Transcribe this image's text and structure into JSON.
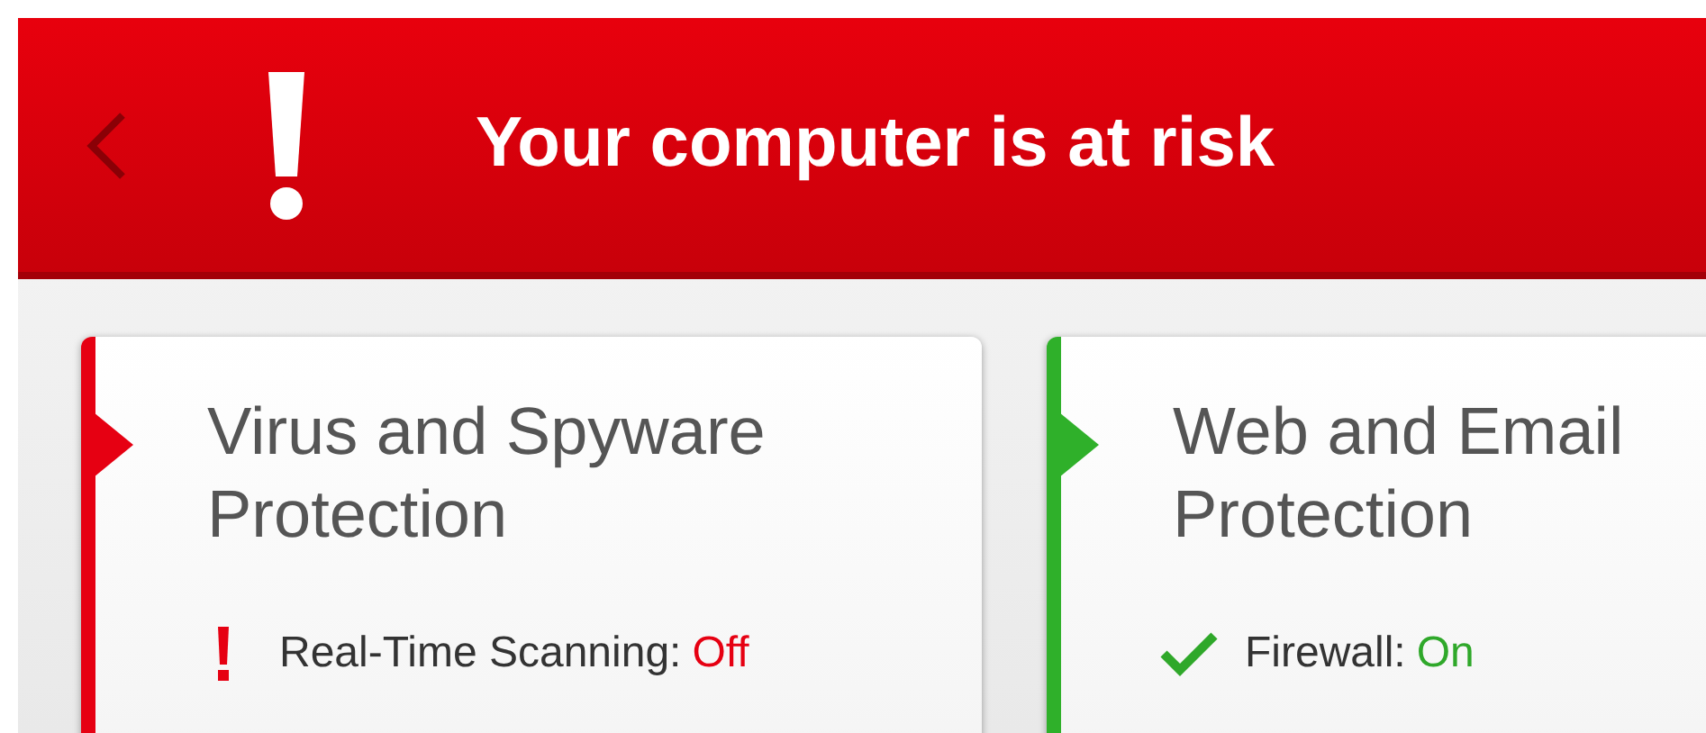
{
  "header": {
    "title": "Your computer is at risk"
  },
  "cards": [
    {
      "title": "Virus and Spyware Protection",
      "color": "#e60012",
      "items": [
        {
          "label": "Real-Time Scanning:",
          "value": "Off",
          "on": false
        }
      ]
    },
    {
      "title": "Web and Email Protection",
      "color": "#2fb02a",
      "items": [
        {
          "label": "Firewall:",
          "value": "On",
          "on": true
        }
      ]
    }
  ]
}
